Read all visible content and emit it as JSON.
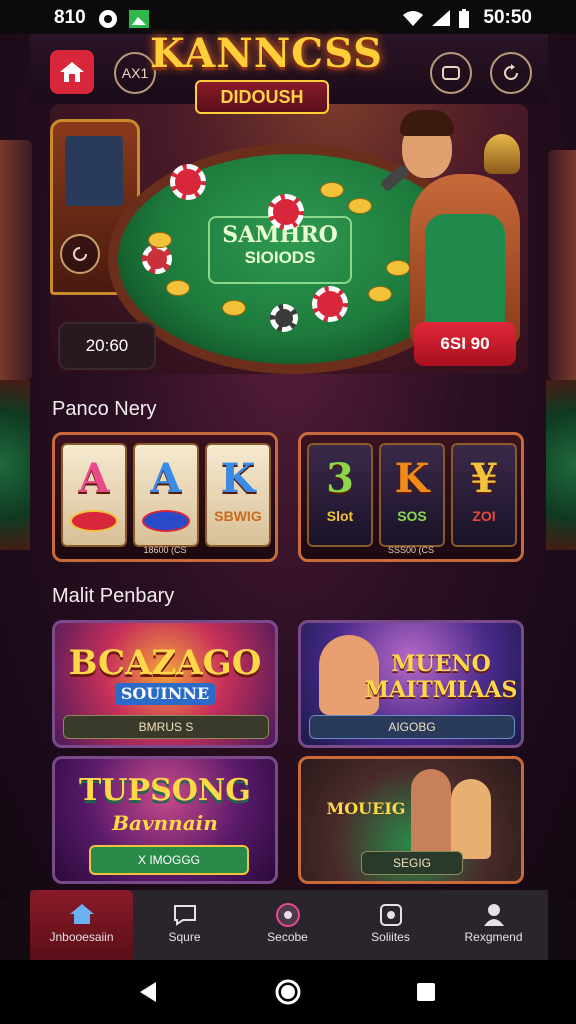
{
  "status_bar": {
    "left_text": "810",
    "time": "50:50"
  },
  "header": {
    "logo_title": "KANNCSS",
    "logo_subtitle": "DIDOUSH",
    "round_btn_label": "AX1",
    "icons": [
      "home-icon",
      "screen-icon",
      "refresh-icon"
    ]
  },
  "hero": {
    "felt_line1": "SAMHRO",
    "felt_line2": "SIOIODS",
    "balance": "20:60",
    "bet": "6SI 90"
  },
  "sections": {
    "popular": "Panco Nery",
    "multi": "Malit Penbary"
  },
  "slot_cards": [
    {
      "reels": [
        {
          "letter": "A",
          "sub": ""
        },
        {
          "letter": "A",
          "sub": ""
        },
        {
          "letter": "K",
          "sub": "SBWIG"
        }
      ],
      "footer": "18600 (CS"
    },
    {
      "reels": [
        {
          "letter": "3",
          "sub": "Slot"
        },
        {
          "letter": "K",
          "sub": "SOS"
        },
        {
          "letter": "¥",
          "sub": "ZOI"
        }
      ],
      "footer": "SSS00 (CS"
    }
  ],
  "game_cards": [
    {
      "title": "BCAZAGO",
      "subtitle": "SOUINNE",
      "pill": "BMRUS S"
    },
    {
      "title": "MUENO MAITMIAAS",
      "subtitle": "",
      "pill": "AIGOBG"
    },
    {
      "title": "TUPSONG",
      "subtitle": "Bavnnain",
      "pill": "X IMOGGG"
    },
    {
      "title": "MOUEIG",
      "subtitle": "",
      "pill": "SEGIG"
    }
  ],
  "bottom_nav": [
    {
      "label": "Jnbooesaiin",
      "icon": "home-icon",
      "active": true
    },
    {
      "label": "Squre",
      "icon": "chat-icon",
      "active": false
    },
    {
      "label": "Secobe",
      "icon": "shield-icon",
      "active": false
    },
    {
      "label": "Soliites",
      "icon": "settings-icon",
      "active": false
    },
    {
      "label": "Rexgmend",
      "icon": "profile-icon",
      "active": false
    }
  ],
  "colors": {
    "accent_red": "#d8263a",
    "felt_green": "#1d7a3c",
    "gold": "#ffcf3a"
  }
}
